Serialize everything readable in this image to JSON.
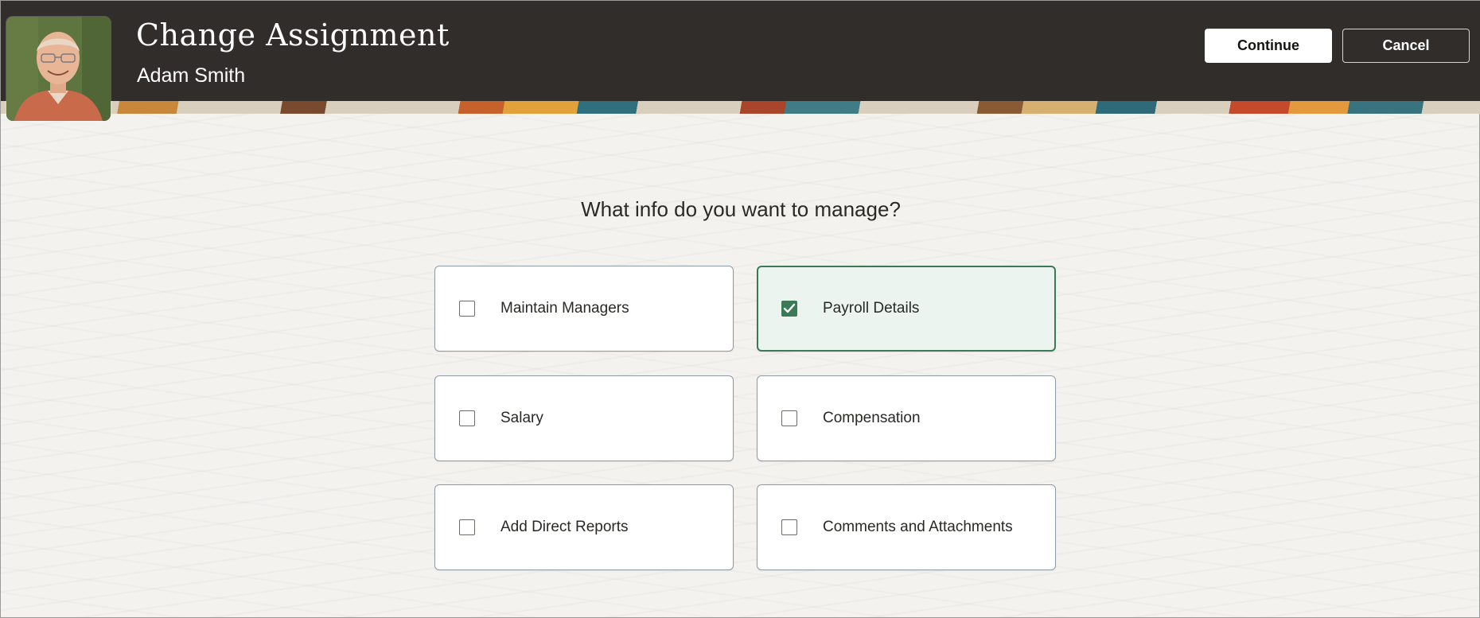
{
  "header": {
    "title": "Change Assignment",
    "person_name": "Adam Smith",
    "continue_label": "Continue",
    "cancel_label": "Cancel"
  },
  "main": {
    "question": "What info do you want to manage?",
    "options": [
      {
        "label": "Maintain Managers",
        "checked": false
      },
      {
        "label": "Payroll Details",
        "checked": true
      },
      {
        "label": "Salary",
        "checked": false
      },
      {
        "label": "Compensation",
        "checked": false
      },
      {
        "label": "Add Direct Reports",
        "checked": false
      },
      {
        "label": "Comments and Attachments",
        "checked": false
      }
    ]
  },
  "colors": {
    "header_bg": "#312d2a",
    "selected_accent": "#3b7a57",
    "selected_bg": "#ebf4ee"
  }
}
